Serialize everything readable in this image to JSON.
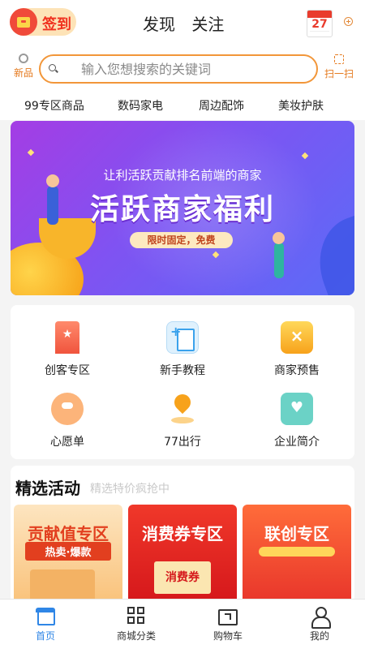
{
  "header": {
    "signin_label": "签到",
    "tabs": [
      "发现",
      "关注"
    ],
    "calendar_day": "27",
    "icons": {
      "signin": "gift-icon",
      "calendar": "calendar-icon",
      "plus": "plus-circle-icon"
    }
  },
  "search": {
    "left_label": "新品",
    "placeholder": "输入您想搜索的关键词",
    "right_label": "扫一扫",
    "icons": {
      "left": "new-icon",
      "search": "search-icon",
      "right": "scan-icon"
    }
  },
  "categories": [
    "99专区商品",
    "数码家电",
    "周边配饰",
    "美妆护肤"
  ],
  "banner": {
    "subtitle": "让利活跃贡献排名前端的商家",
    "title": "活跃商家福利",
    "pill": "限时固定，免费",
    "colors": {
      "from": "#a43de4",
      "to": "#5a6cf7"
    }
  },
  "features": [
    {
      "label": "创客专区",
      "icon": "bookmark-star-icon"
    },
    {
      "label": "新手教程",
      "icon": "document-plus-icon"
    },
    {
      "label": "商家预售",
      "icon": "presale-box-icon"
    },
    {
      "label": "心愿单",
      "icon": "piggy-bank-icon"
    },
    {
      "label": "77出行",
      "icon": "location-pin-icon"
    },
    {
      "label": "企业简介",
      "icon": "heart-hands-icon"
    }
  ],
  "activities": {
    "title": "精选活动",
    "subtitle": "精选特价疯抢中",
    "cards": [
      {
        "title": "贡献值专区",
        "sub": "热卖·爆款"
      },
      {
        "title": "消费券专区",
        "tag": "消费券"
      },
      {
        "title": "联创专区"
      }
    ]
  },
  "nav": {
    "items": [
      {
        "label": "首页",
        "icon": "home-icon"
      },
      {
        "label": "商城分类",
        "icon": "category-grid-icon"
      },
      {
        "label": "购物车",
        "icon": "cart-icon"
      },
      {
        "label": "我的",
        "icon": "user-icon"
      }
    ],
    "active_color": "#2f86e6"
  },
  "accent": "#f29639"
}
